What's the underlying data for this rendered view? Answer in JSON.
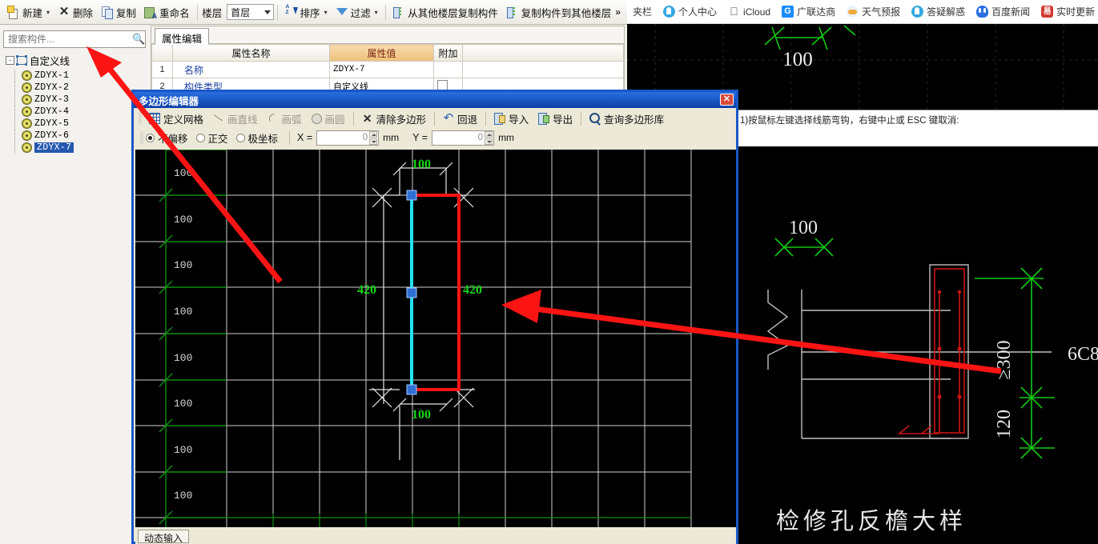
{
  "app": {
    "toolbar": {
      "new": "新建",
      "delete": "删除",
      "copy": "复制",
      "rename": "重命名",
      "level_label": "楼层",
      "level_value": "首层",
      "sort": "排序",
      "filter": "过滤",
      "copy_from_other": "从其他楼层复制构件",
      "copy_to_other": "复制构件到其他楼层",
      "overflow": "»"
    },
    "search": {
      "placeholder": "搜索构件..."
    },
    "tree": {
      "root": "自定义线",
      "expander": "-",
      "children": [
        {
          "label": "ZDYX-1",
          "selected": false
        },
        {
          "label": "ZDYX-2",
          "selected": false
        },
        {
          "label": "ZDYX-3",
          "selected": false
        },
        {
          "label": "ZDYX-4",
          "selected": false
        },
        {
          "label": "ZDYX-5",
          "selected": false
        },
        {
          "label": "ZDYX-6",
          "selected": false
        },
        {
          "label": "ZDYX-7",
          "selected": true
        }
      ]
    },
    "properties": {
      "tab": "属性编辑",
      "headers": {
        "index": "",
        "name": "属性名称",
        "value": "属性值",
        "extra": "附加"
      },
      "rows": [
        {
          "index": "1",
          "name": "名称",
          "value": "ZDYX-7",
          "extra": false
        },
        {
          "index": "2",
          "name": "构件类型",
          "value": "自定义线",
          "extra": true
        }
      ]
    }
  },
  "browser": {
    "bookmarks": [
      {
        "label": "夹栏",
        "icon": "bookmark-bar-icon"
      },
      {
        "label": "个人中心",
        "icon": "person-icon"
      },
      {
        "label": "iCloud",
        "icon": "apple-icon"
      },
      {
        "label": "广联达商",
        "icon": "glodon-g-icon"
      },
      {
        "label": "天气预报",
        "icon": "weather-cloud-icon"
      },
      {
        "label": "答疑解惑",
        "icon": "person-icon"
      },
      {
        "label": "百度新闻",
        "icon": "baidu-icon"
      },
      {
        "label": "实时更新",
        "icon": "update-icon"
      }
    ]
  },
  "cad": {
    "command_prompt": "1)按鼠标左键选择线筋弯钩，右键中止或 ESC 键取消:",
    "drawing_title": "检修孔反檐大样",
    "dimensions": {
      "top": "100",
      "height": "≥300",
      "base": "120",
      "rebar": "6C8",
      "top_far": "100"
    }
  },
  "dialog": {
    "title": "多边形编辑器",
    "close_label": "✕",
    "toolbar": [
      {
        "label": "定义网格",
        "icon": "grid-icon",
        "enabled": true
      },
      {
        "label": "画直线",
        "icon": "line-icon",
        "enabled": false
      },
      {
        "label": "画弧",
        "icon": "arc-icon",
        "enabled": false
      },
      {
        "label": "画圆",
        "icon": "circle-icon",
        "enabled": false
      },
      {
        "label": "清除多边形",
        "icon": "clear-x-icon",
        "enabled": true
      },
      {
        "label": "回退",
        "icon": "undo-icon",
        "enabled": true
      },
      {
        "label": "导入",
        "icon": "import-icon",
        "enabled": true
      },
      {
        "label": "导出",
        "icon": "export-icon",
        "enabled": true
      },
      {
        "label": "查询多边形库",
        "icon": "search-icon",
        "enabled": true
      }
    ],
    "offset_modes": [
      {
        "label": "不偏移",
        "selected": true
      },
      {
        "label": "正交",
        "selected": false
      },
      {
        "label": "极坐标",
        "selected": false
      }
    ],
    "coords": {
      "x_label": "X =",
      "x_value": "0",
      "x_unit": "mm",
      "y_label": "Y =",
      "y_value": "0",
      "y_unit": "mm"
    },
    "footer_tab": "动态输入",
    "canvas": {
      "row_labels": [
        "100",
        "100",
        "100",
        "100",
        "100",
        "100",
        "100",
        "100"
      ],
      "dim_top": "100",
      "dim_bottom": "100",
      "dim_left": "420",
      "dim_right": "420"
    }
  },
  "colors": {
    "dialog_border": "#1a57c8",
    "dialog_titlebar": "#0b3fa8",
    "canvas_bg": "#000000",
    "dim_green": "#16d516",
    "shape_red": "#ff1a1a",
    "shape_cyan": "#23e0f0",
    "node_blue": "#2e6fd8",
    "annotation_red": "#fb1414",
    "selection_blue": "#2558b0",
    "prop_value_header": "#eec07a"
  }
}
